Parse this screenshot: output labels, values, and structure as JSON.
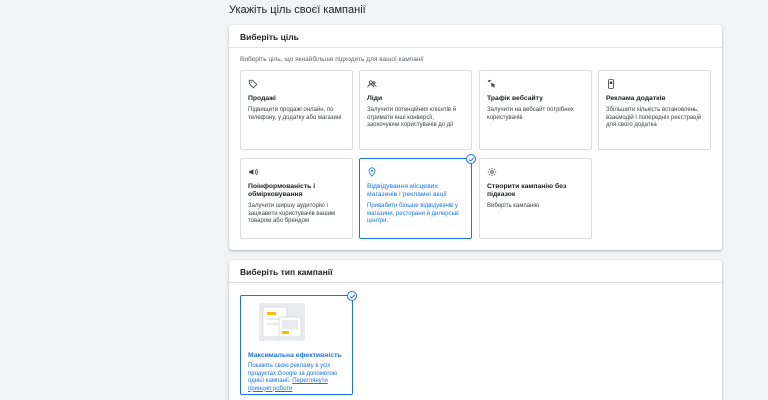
{
  "page": {
    "title": "Укажіть ціль своєї кампанії"
  },
  "goal_card": {
    "header": "Виберіть ціль",
    "subtitle": "Виберіть ціль, що якнайбільше підходить для вашої кампанії",
    "tiles": [
      {
        "icon": "tag-icon",
        "title": "Продажі",
        "desc": "Підвищити продажі онлайн, по телефону, у додатку або магазині",
        "selected": false
      },
      {
        "icon": "people-icon",
        "title": "Ліди",
        "desc": "Залучити потенційних клієнтів й отримати інші конверсії, заохочуючи користувачів до дії",
        "selected": false
      },
      {
        "icon": "cursor-click-icon",
        "title": "Трафік вебсайту",
        "desc": "Залучити на вебсайт потрібних користувачів",
        "selected": false
      },
      {
        "icon": "phone-icon",
        "title": "Реклама додатків",
        "desc": "Збільшити кількість встановлень, взаємодій і попередніх реєстрацій для свого додатка",
        "selected": false
      },
      {
        "icon": "speaker-icon",
        "title": "Поінформованість і обмірковування",
        "desc": "Залучити ширшу аудиторію і зацікавити користувачів вашим товаром або брендом",
        "selected": false
      },
      {
        "icon": "location-pin-icon",
        "title": "Відвідування місцевих магазинів і рекламні акції",
        "desc": "Привабити більше відвідувачів у магазини, ресторани й дилерські центри.",
        "selected": true
      },
      {
        "icon": "gear-icon",
        "title": "Створити кампанію без підказок",
        "desc": "Виберіть кампанію",
        "selected": false
      }
    ]
  },
  "type_card": {
    "header": "Виберіть тип кампанії",
    "tile": {
      "title": "Максимальна ефективність",
      "desc": "Покажіть свою рекламу в усіх продуктах Google за допомогою однієї кампанії.",
      "link": "Переглянути принцип роботи",
      "selected": true
    }
  },
  "colors": {
    "accent": "#1a73e8",
    "text": "#202124",
    "muted": "#5f6368",
    "bg": "#f1f3f4",
    "border": "#dadce0"
  }
}
